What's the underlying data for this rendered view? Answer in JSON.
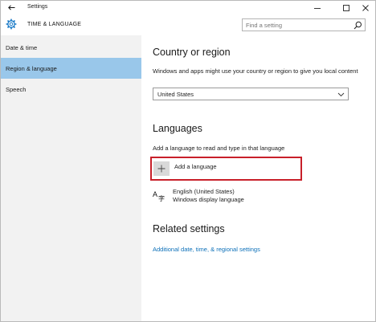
{
  "window": {
    "title": "Settings",
    "icons": {
      "back": "back-arrow-icon",
      "minimize": "minimize-icon",
      "maximize": "maximize-icon",
      "close": "close-icon"
    }
  },
  "header": {
    "section_title": "TIME & LANGUAGE",
    "icon": "gear-icon",
    "search": {
      "placeholder": "Find a setting",
      "value": "",
      "icon": "search-icon"
    }
  },
  "sidebar": {
    "items": [
      {
        "label": "Date & time",
        "selected": false
      },
      {
        "label": "Region & language",
        "selected": true
      },
      {
        "label": "Speech",
        "selected": false
      }
    ],
    "selected_color": "#99c7ea"
  },
  "main": {
    "country": {
      "heading": "Country or region",
      "description": "Windows and apps might use your country or region to give you local content",
      "dropdown_value": "United States"
    },
    "languages": {
      "heading": "Languages",
      "description": "Add a language to read and type in that language",
      "add_label": "Add a language",
      "highlight_color": "#c8202a",
      "entries": [
        {
          "name": "English (United States)",
          "detail": "Windows display language",
          "icon": "language-icon"
        }
      ]
    },
    "related": {
      "heading": "Related settings",
      "link": "Additional date, time, & regional settings",
      "link_color": "#0b6fb8"
    }
  }
}
